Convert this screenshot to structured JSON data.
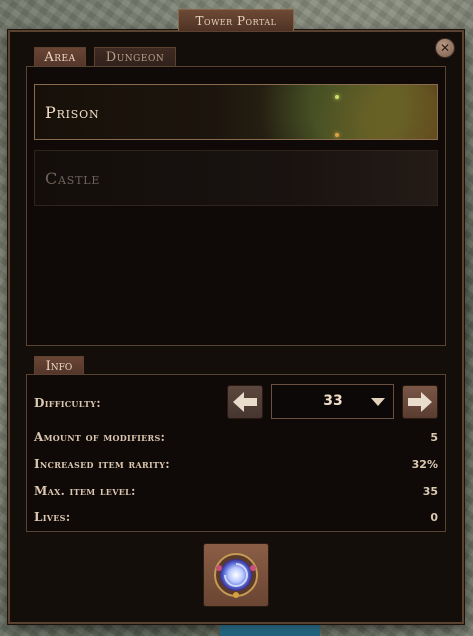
{
  "window": {
    "title": "Tower Portal"
  },
  "tabs": [
    {
      "label": "Area",
      "active": true
    },
    {
      "label": "Dungeon",
      "active": false
    }
  ],
  "areas": [
    {
      "name": "Prison",
      "selected": true
    },
    {
      "name": "Castle",
      "selected": false
    }
  ],
  "info": {
    "tab_label": "Info",
    "difficulty_label": "Difficulty:",
    "difficulty_value": "33",
    "stats": [
      {
        "label": "Amount of modifiers:",
        "value": "5"
      },
      {
        "label": "Increased item rarity:",
        "value": "32%"
      },
      {
        "label": "Max. item level:",
        "value": "35"
      },
      {
        "label": "Lives:",
        "value": "0"
      }
    ]
  },
  "icons": {
    "close": "close-icon",
    "prev": "arrow-left-icon",
    "next": "arrow-right-icon",
    "dropdown": "chevron-down-icon",
    "portal": "portal-icon"
  },
  "colors": {
    "panel_bg": "#140e0b",
    "border": "#5a4230",
    "tab_active": "#6a4534",
    "text_light": "#f0dfc8",
    "text_locked": "#6f6258"
  }
}
